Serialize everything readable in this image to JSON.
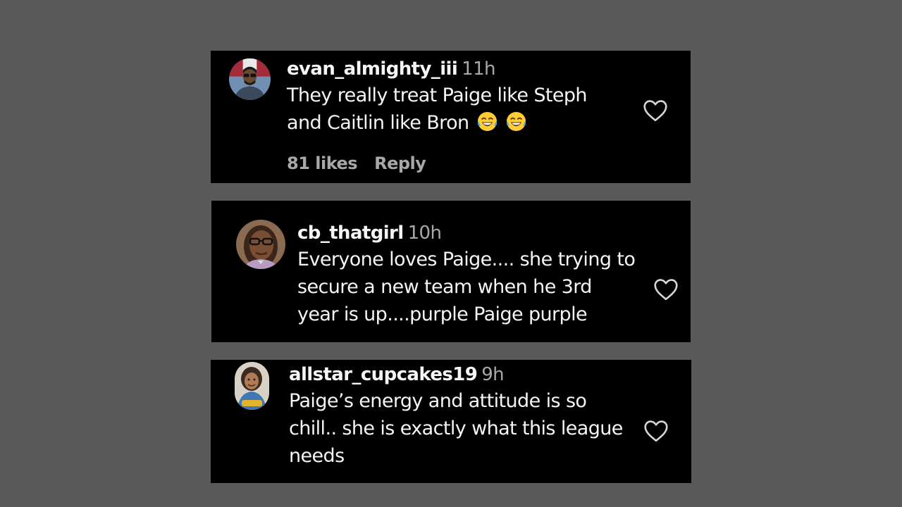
{
  "comments": [
    {
      "username": "evan_almighty_iii",
      "time": "11h",
      "lines": [
        "They really treat Paige like Steph",
        "and Caitlin like Bron"
      ],
      "emoji": [
        "face-with-tears-of-joy",
        "face-with-tears-of-joy"
      ],
      "likes": "81 likes",
      "reply": "Reply"
    },
    {
      "username": "cb_thatgirl",
      "time": "10h",
      "lines": [
        "Everyone loves Paige.... she trying to",
        "secure a new team when he 3rd",
        "year is up....purple Paige purple"
      ]
    },
    {
      "username": "allstar_cupcakes19",
      "time": "9h",
      "lines": [
        "Paige’s energy and attitude is so",
        "chill.. she is exactly what this league",
        "needs"
      ]
    }
  ],
  "colors": {
    "page_background": "#595959",
    "card_background": "#000000",
    "primary_text": "#f5f5f5",
    "secondary_text": "#a8a8a8"
  },
  "icons": {
    "like": "heart-outline-icon"
  }
}
